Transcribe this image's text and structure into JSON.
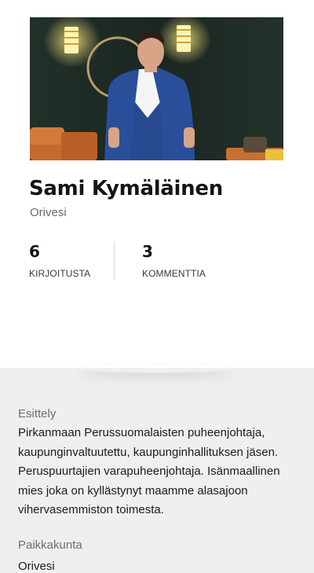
{
  "profile": {
    "name": "Sami Kymäläinen",
    "location": "Orivesi",
    "stats": [
      {
        "value": "6",
        "label": "KIRJOITUSTA"
      },
      {
        "value": "3",
        "label": "KOMMENTTIA"
      }
    ]
  },
  "details": {
    "intro_label": "Esittely",
    "intro_text": "Pirkanmaan Perussuomalaisten puheenjohtaja, kaupunginvaltuutettu, kaupunginhallituksen jäsen. Peruspuurtajien varapuheenjohtaja. Isänmaallinen mies joka on kyllästynyt maamme alasajoon vihervasemmiston toimesta.",
    "home_label": "Paikkakunta",
    "home_value": "Orivesi"
  }
}
